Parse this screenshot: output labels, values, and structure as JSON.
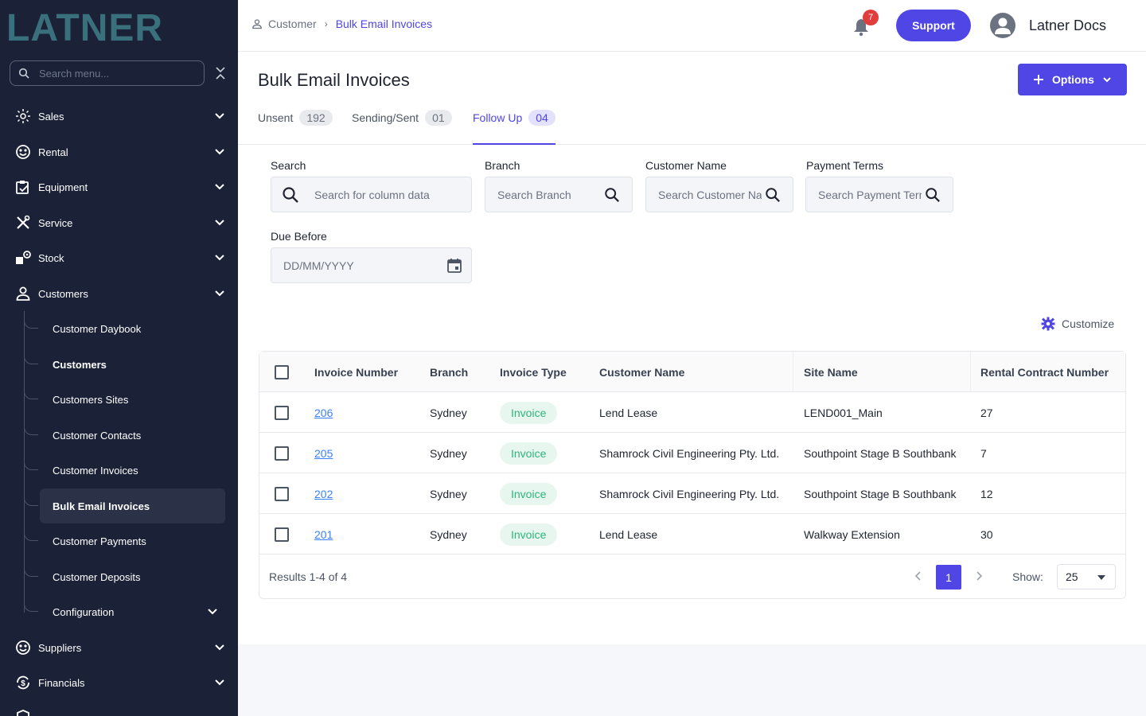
{
  "sidebar": {
    "brand": "LATNER",
    "search_placeholder": "Search menu...",
    "items": [
      {
        "label": "Sales",
        "icon": "sales-icon"
      },
      {
        "label": "Rental",
        "icon": "rental-icon"
      },
      {
        "label": "Equipment",
        "icon": "equipment-icon"
      },
      {
        "label": "Service",
        "icon": "service-icon"
      },
      {
        "label": "Stock",
        "icon": "stock-icon"
      },
      {
        "label": "Customers",
        "icon": "user-icon"
      },
      {
        "label": "Suppliers",
        "icon": "suppliers-icon"
      },
      {
        "label": "Financials",
        "icon": "financials-icon"
      }
    ],
    "customers_sub": [
      {
        "label": "Customer Daybook"
      },
      {
        "label": "Customers"
      },
      {
        "label": "Customers Sites"
      },
      {
        "label": "Customer Contacts"
      },
      {
        "label": "Customer Invoices"
      },
      {
        "label": "Bulk Email Invoices"
      },
      {
        "label": "Customer Payments"
      },
      {
        "label": "Customer Deposits"
      },
      {
        "label": "Configuration"
      }
    ],
    "colors": {
      "background": "#1b2238",
      "active_item": "#2b3248",
      "logo": "#3a6f7c"
    }
  },
  "header": {
    "breadcrumb": [
      "Customer",
      "Bulk Email Invoices"
    ],
    "notification_count": "7",
    "support_label": "Support",
    "user_name": "Latner Docs"
  },
  "page": {
    "title": "Bulk Email Invoices",
    "options_label": "Options",
    "tabs": [
      {
        "label": "Unsent",
        "count": "192"
      },
      {
        "label": "Sending/Sent",
        "count": "01"
      },
      {
        "label": "Follow Up",
        "count": "04",
        "active": true
      }
    ],
    "accent_color": "#4f46e5"
  },
  "filters": {
    "search": {
      "label": "Search",
      "placeholder": "Search for column data"
    },
    "branch": {
      "label": "Branch",
      "placeholder": "Search Branch"
    },
    "customer_name": {
      "label": "Customer Name",
      "placeholder": "Search Customer Name"
    },
    "payment_terms": {
      "label": "Payment Terms",
      "placeholder": "Search Payment Terms"
    },
    "due_before": {
      "label": "Due Before",
      "placeholder": "DD/MM/YYYY"
    }
  },
  "customize_label": "Customize",
  "table": {
    "columns": [
      "Invoice Number",
      "Branch",
      "Invoice Type",
      "Customer Name",
      "Site Name",
      "Rental Contract Number"
    ],
    "rows": [
      {
        "invoice_number": "206",
        "branch": "Sydney",
        "invoice_type": "Invoice",
        "customer_name": "Lend Lease",
        "site_name": "LEND001_Main",
        "rental_contract": "27"
      },
      {
        "invoice_number": "205",
        "branch": "Sydney",
        "invoice_type": "Invoice",
        "customer_name": "Shamrock Civil Engineering Pty. Ltd.",
        "site_name": "Southpoint Stage B Southbank",
        "rental_contract": "7"
      },
      {
        "invoice_number": "202",
        "branch": "Sydney",
        "invoice_type": "Invoice",
        "customer_name": "Shamrock Civil Engineering Pty. Ltd.",
        "site_name": "Southpoint Stage B Southbank",
        "rental_contract": "12"
      },
      {
        "invoice_number": "201",
        "branch": "Sydney",
        "invoice_type": "Invoice",
        "customer_name": "Lend Lease",
        "site_name": "Walkway Extension",
        "rental_contract": "30"
      }
    ],
    "footer": {
      "results": "Results 1-4 of 4",
      "current_page": "1",
      "show_label": "Show:",
      "page_size": "25"
    }
  }
}
